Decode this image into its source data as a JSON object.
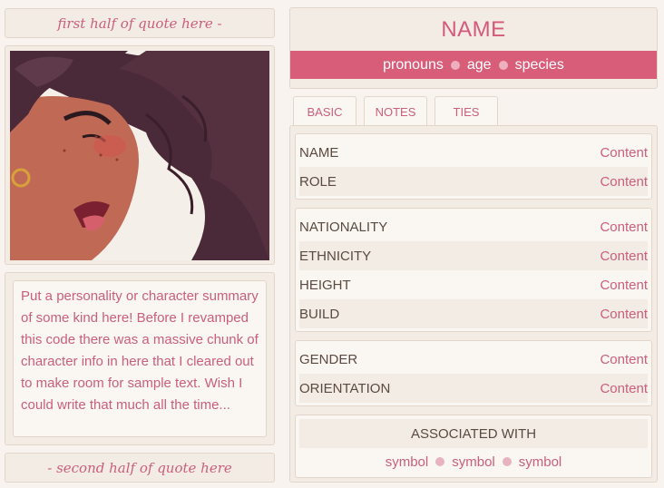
{
  "quotes": {
    "top": "first half of quote here -",
    "bottom": "- second half of quote here"
  },
  "summary": "Put a personality or character summary of some kind here! Before I revamped this code there was a massive chunk of character info in here that I cleared out to make room for sample text. Wish I could write that much all the time...",
  "header": {
    "name": "NAME",
    "pronouns": "pronouns",
    "age": "age",
    "species": "species"
  },
  "tabs": [
    {
      "label": "BASIC"
    },
    {
      "label": "NOTES"
    },
    {
      "label": "TIES"
    }
  ],
  "groups": {
    "identity": [
      {
        "label": "NAME",
        "value": "Content"
      },
      {
        "label": "ROLE",
        "value": "Content"
      }
    ],
    "physical": [
      {
        "label": "NATIONALITY",
        "value": "Content"
      },
      {
        "label": "ETHNICITY",
        "value": "Content"
      },
      {
        "label": "HEIGHT",
        "value": "Content"
      },
      {
        "label": "BUILD",
        "value": "Content"
      }
    ],
    "gender": [
      {
        "label": "GENDER",
        "value": "Content"
      },
      {
        "label": "ORIENTATION",
        "value": "Content"
      }
    ]
  },
  "associated": {
    "heading": "ASSOCIATED WITH",
    "symbols": [
      "symbol",
      "symbol",
      "symbol"
    ]
  },
  "colors": {
    "accent": "#d75d79",
    "text_pink": "#c95f7c",
    "panel": "#f3ece5",
    "background": "#f8f3ee"
  },
  "portrait": {
    "icon": "character-portrait-illustration"
  }
}
